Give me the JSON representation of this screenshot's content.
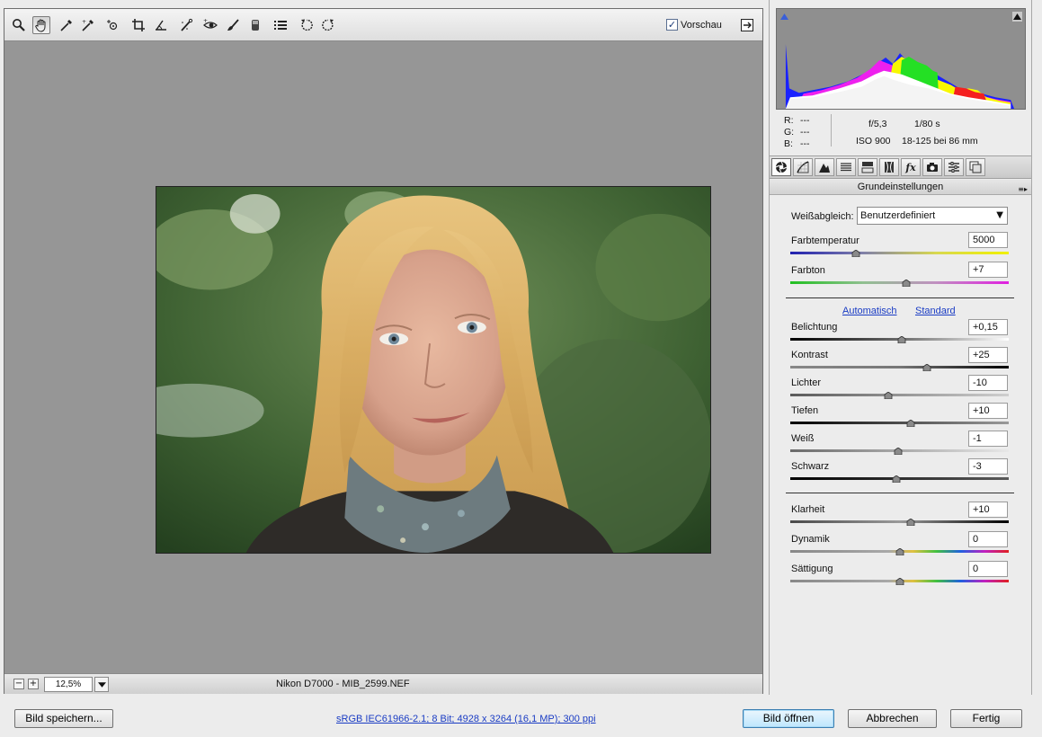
{
  "toolbar": {
    "tools": [
      "zoom-tool",
      "hand-tool",
      "white-balance-tool",
      "color-sampler-tool",
      "targeted-adjustment-tool",
      "crop-tool",
      "straighten-tool",
      "spot-removal-tool",
      "red-eye-removal-tool",
      "adjustment-brush",
      "graduated-filter",
      "preferences",
      "rotate-ccw",
      "rotate-cw"
    ],
    "active_tool": "hand-tool",
    "preview_label": "Vorschau",
    "preview_checked": true
  },
  "status": {
    "zoom_value": "12,5%",
    "filename": "Nikon D7000 - MIB_2599.NEF"
  },
  "readout": {
    "r_label": "R:",
    "r_value": "---",
    "g_label": "G:",
    "g_value": "---",
    "b_label": "B:",
    "b_value": "---",
    "aperture": "f/5,3",
    "shutter": "1/80 s",
    "iso": "ISO 900",
    "lens": "18-125 bei 86 mm"
  },
  "panel": {
    "tabs": [
      "Grundeinstellungen",
      "Gradationskurve",
      "Details",
      "HSL / Graustufen",
      "Teiltonung",
      "Objektivkorrekturen",
      "Effekte",
      "Kamerakalibrierung",
      "Vorgaben",
      "Schnappschüsse"
    ],
    "active_tab": 0,
    "title": "Grundeinstellungen",
    "wb_label": "Weißabgleich:",
    "wb_value": "Benutzerdefiniert",
    "auto_link": "Automatisch",
    "default_link": "Standard",
    "sliders": {
      "temperature": {
        "label": "Farbtemperatur",
        "value": "5000",
        "fraction": 0.3
      },
      "tint": {
        "label": "Farbton",
        "value": "+7",
        "fraction": 0.53
      },
      "exposure": {
        "label": "Belichtung",
        "value": "+0,15",
        "fraction": 0.51
      },
      "contrast": {
        "label": "Kontrast",
        "value": "+25",
        "fraction": 0.625
      },
      "highlights": {
        "label": "Lichter",
        "value": "-10",
        "fraction": 0.45
      },
      "shadows": {
        "label": "Tiefen",
        "value": "+10",
        "fraction": 0.55
      },
      "whites": {
        "label": "Weiß",
        "value": "-1",
        "fraction": 0.495
      },
      "blacks": {
        "label": "Schwarz",
        "value": "-3",
        "fraction": 0.485
      },
      "clarity": {
        "label": "Klarheit",
        "value": "+10",
        "fraction": 0.55
      },
      "vibrance": {
        "label": "Dynamik",
        "value": "0",
        "fraction": 0.5
      },
      "saturation": {
        "label": "Sättigung",
        "value": "0",
        "fraction": 0.5
      }
    }
  },
  "footer": {
    "save_label": "Bild speichern...",
    "info_link": "sRGB IEC61966-2.1; 8 Bit; 4928 x 3264 (16,1 MP); 300 ppi",
    "open_label": "Bild öffnen",
    "cancel_label": "Abbrechen",
    "done_label": "Fertig"
  }
}
